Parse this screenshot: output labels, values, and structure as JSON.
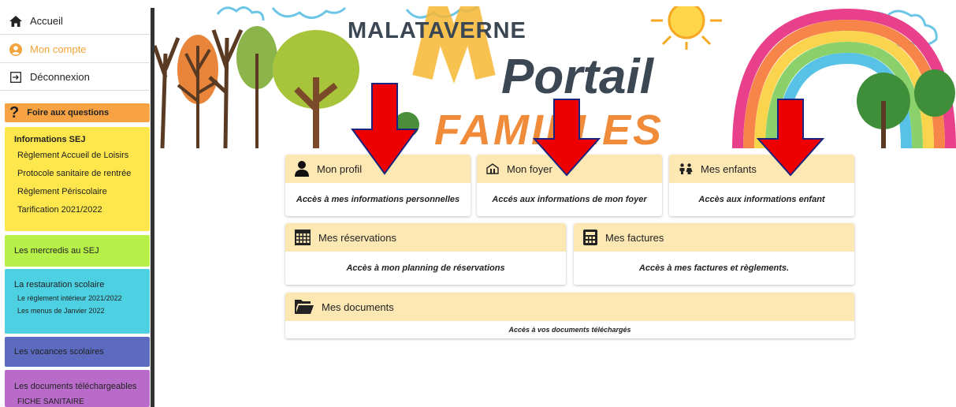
{
  "nav": {
    "home": "Accueil",
    "account": "Mon compte",
    "logout": "Déconnexion"
  },
  "faq": "Foire aux questions",
  "sej": {
    "title": "Informations SEJ",
    "items": [
      "Règlement Accueil de Loisirs",
      "Protocole sanitaire de rentrée",
      "Règlement Périscolaire",
      "Tarification 2021/2022"
    ]
  },
  "mercredis": "Les mercredis au SEJ",
  "restauration": {
    "title": "La restauration scolaire",
    "items": [
      "Le règlement intérieur 2021/2022",
      "Les menus de Janvier 2022"
    ]
  },
  "vacances": "Les vacances scolaires",
  "documents_tel": {
    "title": "Les documents téléchargeables",
    "items": [
      "FICHE SANITAIRE"
    ]
  },
  "banner": {
    "town": "MALATAVERNE",
    "word1": "Portail",
    "word2": "FAMILLES"
  },
  "cards": {
    "profil": {
      "title": "Mon profil",
      "desc": "Accès à mes informations personnelles",
      "icon": "user-icon"
    },
    "foyer": {
      "title": "Mon foyer",
      "desc": "Accés aux informations de mon foyer",
      "icon": "house-icon"
    },
    "enfants": {
      "title": "Mes enfants",
      "desc": "Accès aux informations enfant",
      "icon": "children-icon"
    },
    "reservations": {
      "title": "Mes réservations",
      "desc": "Accès à mon planning de réservations",
      "icon": "calendar-icon"
    },
    "factures": {
      "title": "Mes factures",
      "desc": "Accès à mes factures et règlements.",
      "icon": "calculator-icon"
    },
    "documents": {
      "title": "Mes documents",
      "desc": "Accès à vos documents téléchargés",
      "icon": "folder-icon"
    }
  },
  "colors": {
    "account_accent": "#f2a33a",
    "faq": "#f7a343",
    "sej": "#fde74c",
    "mercredis": "#b8f04a",
    "restauration": "#4dd0e1",
    "vacances": "#5c6bc0",
    "documents": "#b86bc9",
    "card_header": "#fde8b4",
    "arrow": "#ee0000"
  }
}
